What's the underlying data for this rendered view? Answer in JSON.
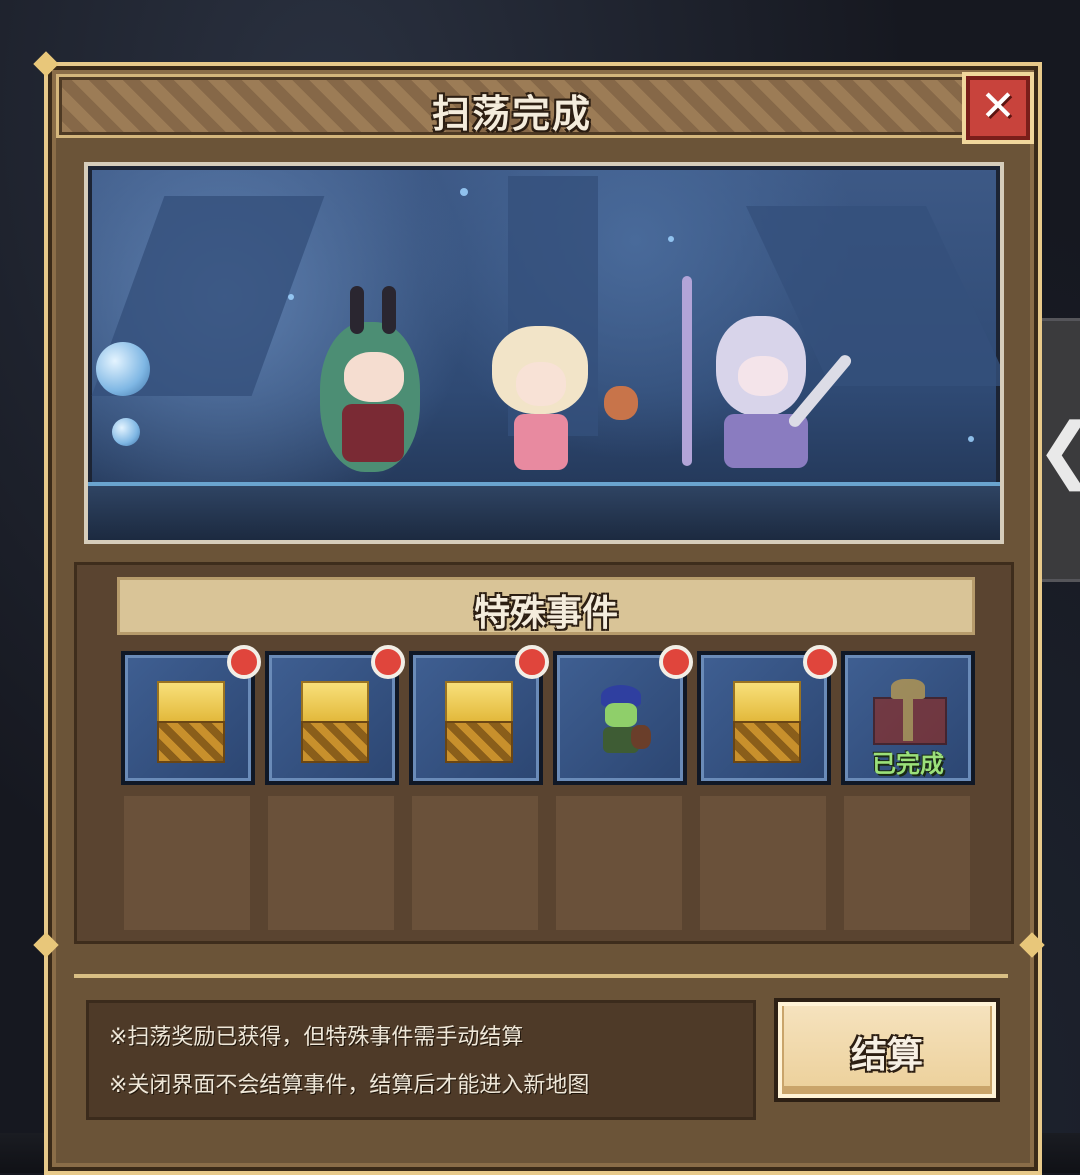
{
  "dialog": {
    "title": "扫荡完成",
    "close_icon": "✕"
  },
  "events": {
    "header": "特殊事件",
    "slots": [
      {
        "type": "chest",
        "icon": "treasure-chest-icon",
        "new": true
      },
      {
        "type": "chest",
        "icon": "treasure-chest-icon",
        "new": true
      },
      {
        "type": "chest",
        "icon": "treasure-chest-icon",
        "new": true
      },
      {
        "type": "goblin",
        "icon": "goblin-merchant-icon",
        "new": true
      },
      {
        "type": "chest",
        "icon": "treasure-chest-icon",
        "new": true
      },
      {
        "type": "gift",
        "icon": "gift-box-icon",
        "new": false,
        "status": "已完成"
      }
    ],
    "empty_slots": 6
  },
  "footer": {
    "note_1": "※扫荡奖励已获得，但特殊事件需手动结算",
    "note_2": "※关闭界面不会结算事件，结算后才能进入新地图",
    "settle_button": "结算"
  },
  "side_tab": {
    "arrow": "❮"
  },
  "colors": {
    "panel": "#6b5438",
    "accent_gold": "#e7c98a",
    "close_red": "#c8433c",
    "new_dot": "#e0453c",
    "completed_green": "#9be07a"
  }
}
